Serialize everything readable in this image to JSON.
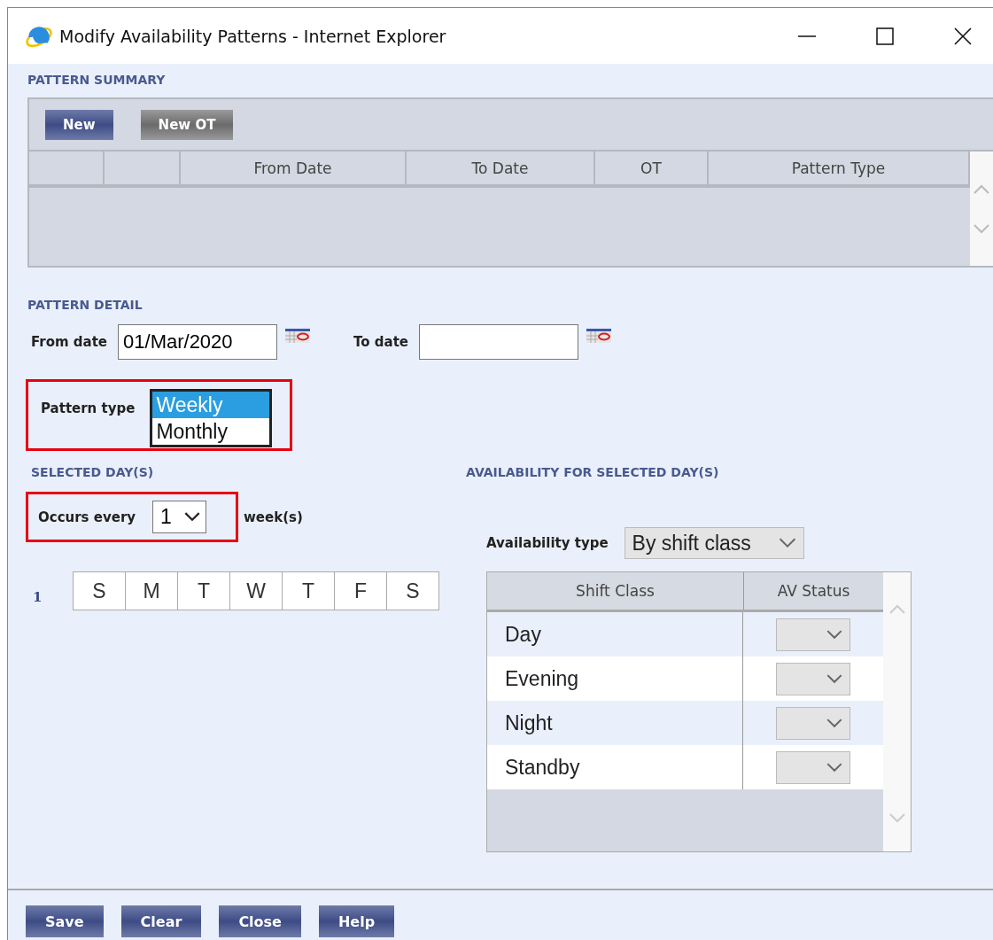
{
  "window": {
    "title": "Modify Availability Patterns - Internet Explorer"
  },
  "pattern_summary": {
    "heading": "PATTERN SUMMARY",
    "buttons": [
      {
        "label": "New",
        "disabled": false
      },
      {
        "label": "New OT",
        "disabled": true
      }
    ],
    "columns": [
      "From Date",
      "To Date",
      "OT",
      "Pattern Type"
    ]
  },
  "pattern_detail": {
    "heading": "PATTERN DETAIL",
    "from_date": {
      "label": "From date",
      "value": "01/Mar/2020"
    },
    "to_date": {
      "label": "To date"
    },
    "pattern_type": {
      "label": "Pattern type",
      "highlighted": true,
      "options": [
        {
          "label": "Weekly",
          "selected": true
        },
        {
          "label": "Monthly",
          "selected": false
        }
      ]
    }
  },
  "selected_days": {
    "heading": "SELECTED DAY(S)",
    "occurs": {
      "label": "Occurs every",
      "value": "1",
      "unit": "week(s)",
      "highlighted": true
    },
    "weeks": [
      {
        "number": "1",
        "days": [
          "S",
          "M",
          "T",
          "W",
          "T",
          "F",
          "S"
        ]
      }
    ]
  },
  "availability": {
    "heading": "AVAILABILITY FOR SELECTED DAY(S)",
    "type": {
      "label": "Availability type",
      "value": "By shift class"
    },
    "columns": [
      "Shift Class",
      "AV Status"
    ],
    "rows": [
      {
        "shift_class": "Day"
      },
      {
        "shift_class": "Evening"
      },
      {
        "shift_class": "Night"
      },
      {
        "shift_class": "Standby"
      }
    ]
  },
  "footer_buttons": [
    "Save",
    "Clear",
    "Close",
    "Help"
  ]
}
